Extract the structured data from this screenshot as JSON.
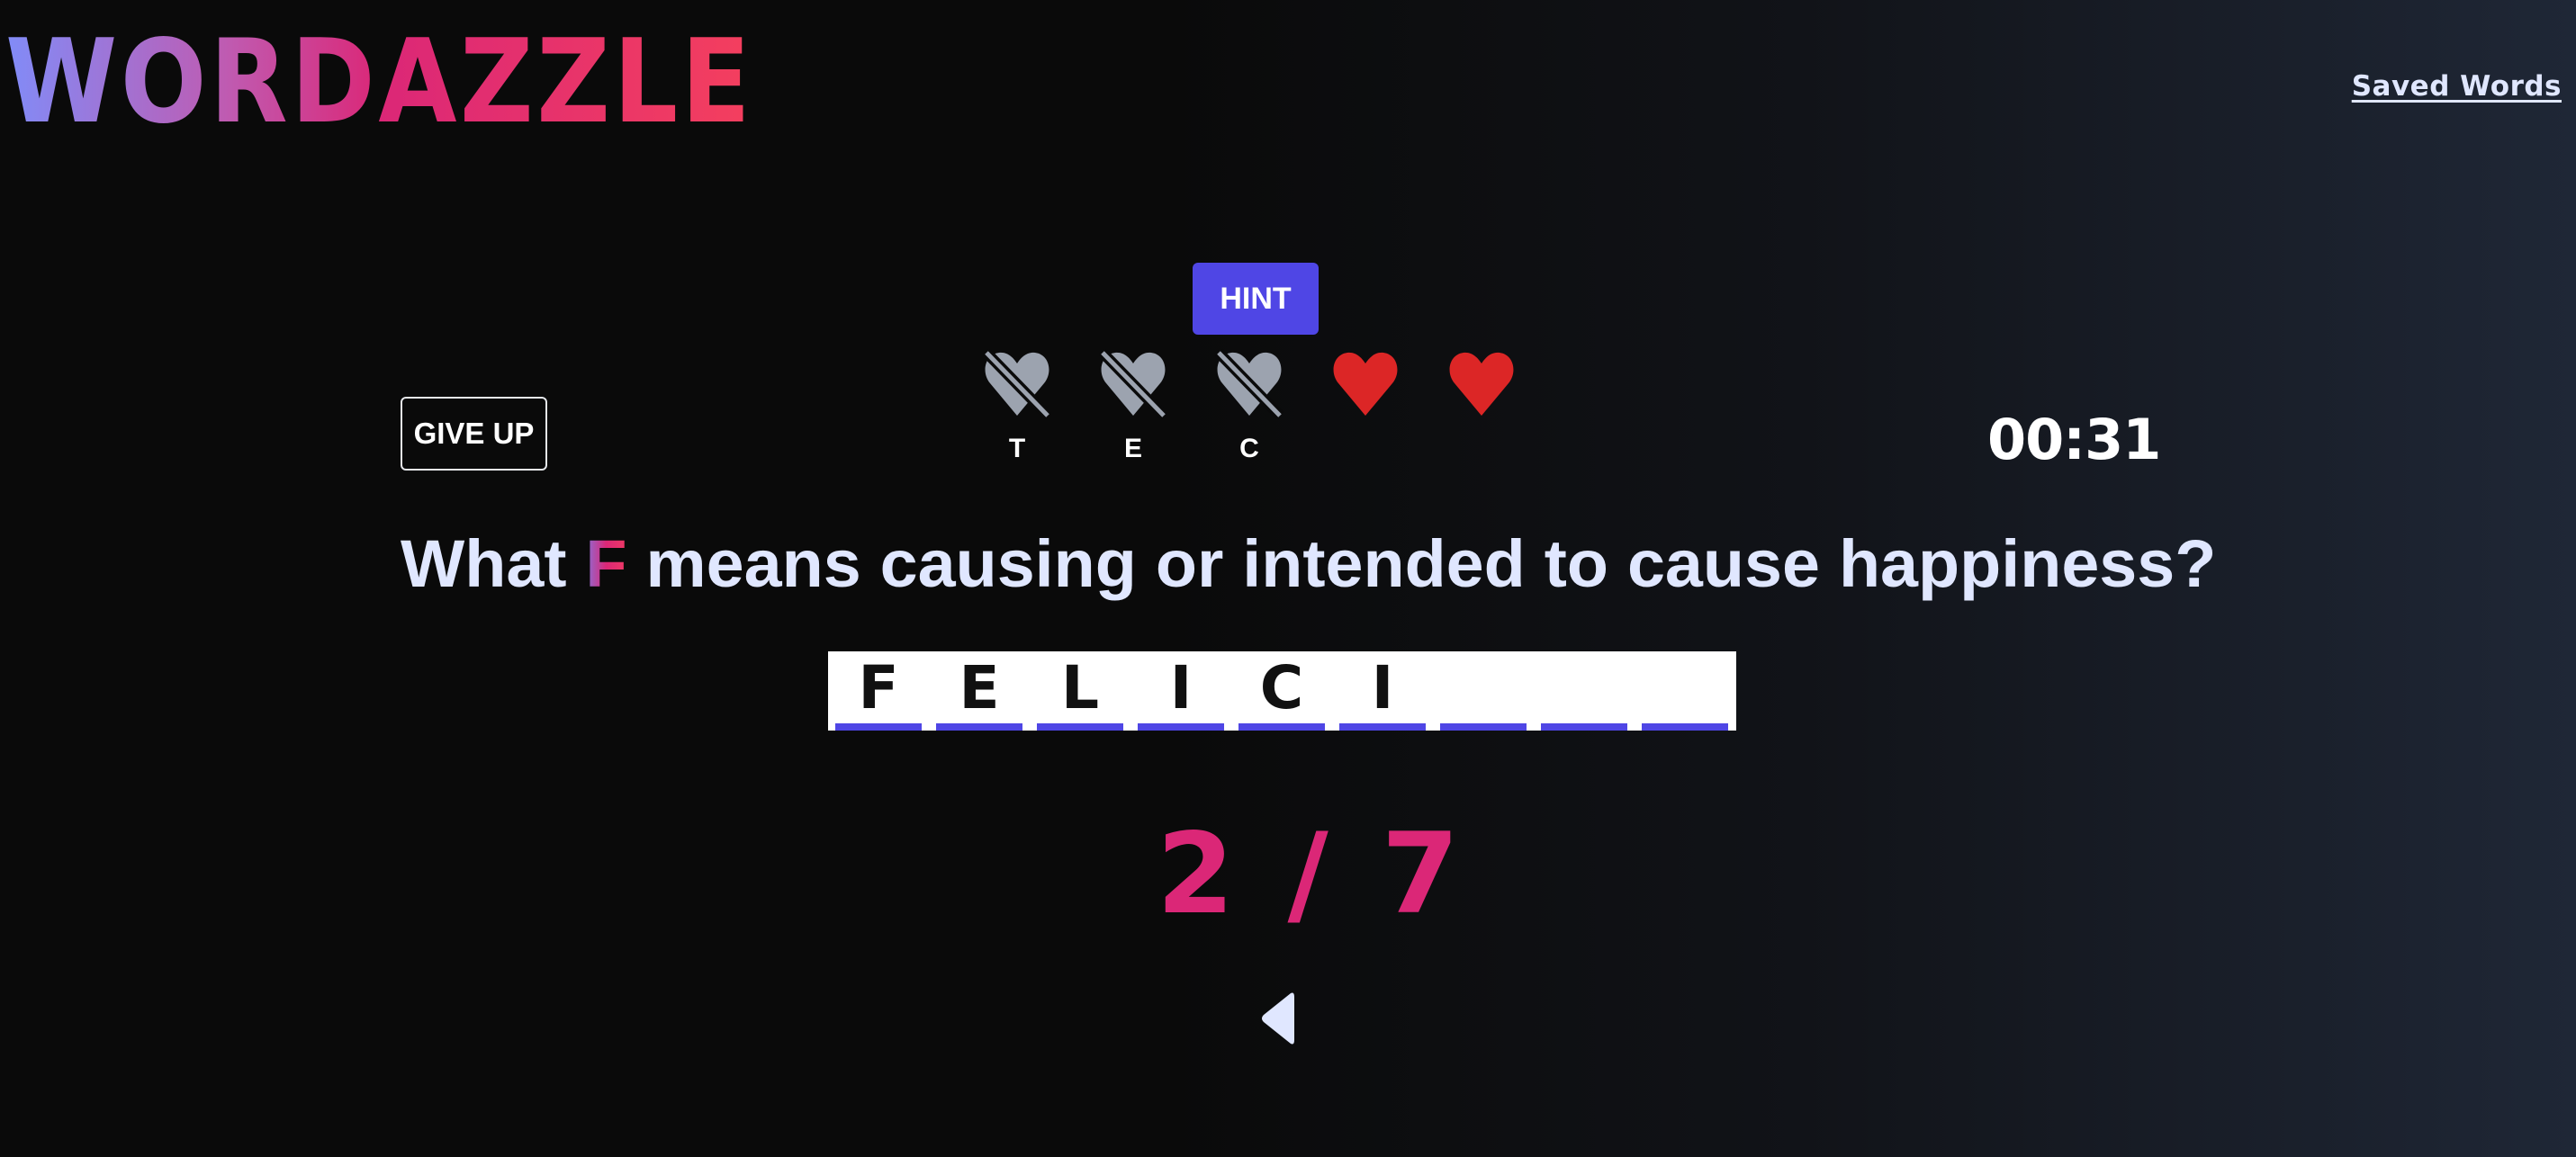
{
  "app": {
    "title": "WORDAZZLE",
    "saved_words_label": "Saved Words"
  },
  "controls": {
    "hint_label": "HINT",
    "give_up_label": "GIVE UP",
    "timer": "00:31"
  },
  "lives": {
    "total": 5,
    "remaining": 2,
    "items": [
      {
        "state": "lost",
        "icon": "heart-off-icon",
        "letter": "T"
      },
      {
        "state": "lost",
        "icon": "heart-off-icon",
        "letter": "E"
      },
      {
        "state": "lost",
        "icon": "heart-off-icon",
        "letter": "C"
      },
      {
        "state": "alive",
        "icon": "heart-icon",
        "letter": ""
      },
      {
        "state": "alive",
        "icon": "heart-icon",
        "letter": ""
      }
    ]
  },
  "question": {
    "prefix": "What ",
    "start_letter": "F",
    "suffix": " means causing or intended to cause happiness?"
  },
  "answer": {
    "length": 9,
    "slots": [
      "F",
      "E",
      "L",
      "I",
      "C",
      "I",
      "",
      "",
      ""
    ]
  },
  "progress": {
    "current": 2,
    "total": 7,
    "label": "2 / 7"
  },
  "navigation": {
    "back_icon": "triangle-left-icon"
  },
  "colors": {
    "accent": "#4f46e5",
    "progress": "#db2777",
    "heart_alive": "#dc2626",
    "heart_lost": "#9ca3af",
    "text": "#e0e7ff"
  }
}
